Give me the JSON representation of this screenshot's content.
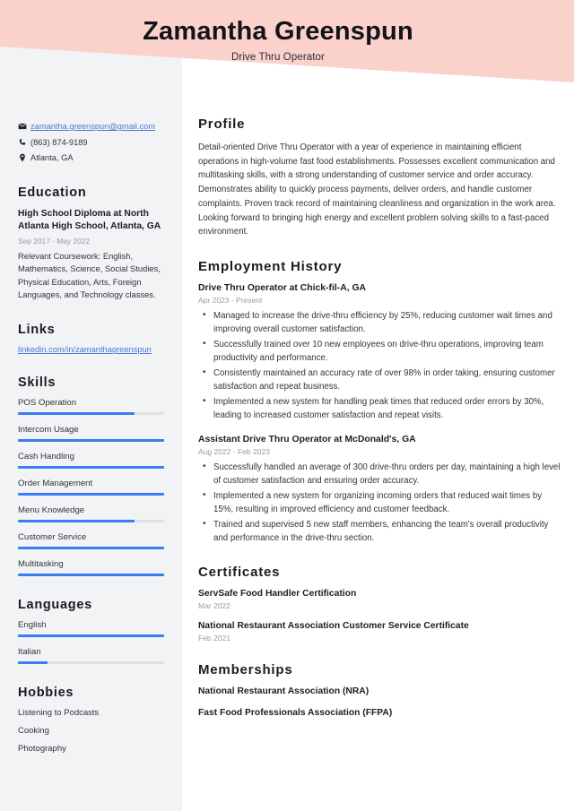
{
  "theme": {
    "accent_pink": "#fbd1cc",
    "accent_blue": "#3b7df5",
    "link_blue": "#4a78d8",
    "sidebar_bg": "#f1f3f4",
    "text_dark": "#1d1d28",
    "text_body": "#33333d",
    "text_muted": "#9a9aa4"
  },
  "header": {
    "name": "Zamantha Greenspun",
    "job_title": "Drive Thru Operator"
  },
  "contact": {
    "email": "zamantha.greenspun@gmail.com",
    "phone": "(863) 874-9189",
    "location": "Atlanta, GA",
    "email_icon": "envelope-icon",
    "phone_icon": "phone-icon",
    "location_icon": "map-pin-icon"
  },
  "education": {
    "heading": "Education",
    "items": [
      {
        "title": "High School Diploma at North Atlanta High School, Atlanta, GA",
        "date": "Sep 2017 - May 2022",
        "description": "Relevant Coursework: English, Mathematics, Science, Social Studies, Physical Education, Arts, Foreign Languages, and Technology classes."
      }
    ]
  },
  "links": {
    "heading": "Links",
    "items": [
      {
        "label": "linkedin.com/in/zamanthagreenspun"
      }
    ]
  },
  "skills": {
    "heading": "Skills",
    "items": [
      {
        "label": "POS Operation",
        "level": 80
      },
      {
        "label": "Intercom Usage",
        "level": 100
      },
      {
        "label": "Cash Handling",
        "level": 100
      },
      {
        "label": "Order Management",
        "level": 100
      },
      {
        "label": "Menu Knowledge",
        "level": 80
      },
      {
        "label": "Customer Service",
        "level": 100
      },
      {
        "label": "Multitasking",
        "level": 100
      }
    ]
  },
  "languages": {
    "heading": "Languages",
    "items": [
      {
        "label": "English",
        "level": 100
      },
      {
        "label": "Italian",
        "level": 20
      }
    ]
  },
  "hobbies": {
    "heading": "Hobbies",
    "items": [
      {
        "label": "Listening to Podcasts"
      },
      {
        "label": "Cooking"
      },
      {
        "label": "Photography"
      }
    ]
  },
  "profile": {
    "heading": "Profile",
    "text": "Detail-oriented Drive Thru Operator with a year of experience in maintaining efficient operations in high-volume fast food establishments. Possesses excellent communication and multitasking skills, with a strong understanding of customer service and order accuracy. Demonstrates ability to quickly process payments, deliver orders, and handle customer complaints. Proven track record of maintaining cleanliness and organization in the work area. Looking forward to bringing high energy and excellent problem solving skills to a fast-paced environment."
  },
  "employment": {
    "heading": "Employment History",
    "jobs": [
      {
        "title": "Drive Thru Operator at Chick-fil-A, GA",
        "date": "Apr 2023 - Present",
        "bullets": [
          "Managed to increase the drive-thru efficiency by 25%, reducing customer wait times and improving overall customer satisfaction.",
          "Successfully trained over 10 new employees on drive-thru operations, improving team productivity and performance.",
          "Consistently maintained an accuracy rate of over 98% in order taking, ensuring customer satisfaction and repeat business.",
          "Implemented a new system for handling peak times that reduced order errors by 30%, leading to increased customer satisfaction and repeat visits."
        ]
      },
      {
        "title": "Assistant Drive Thru Operator at McDonald's, GA",
        "date": "Aug 2022 - Feb 2023",
        "bullets": [
          "Successfully handled an average of 300 drive-thru orders per day, maintaining a high level of customer satisfaction and ensuring order accuracy.",
          "Implemented a new system for organizing incoming orders that reduced wait times by 15%, resulting in improved efficiency and customer feedback.",
          "Trained and supervised 5 new staff members, enhancing the team's overall productivity and performance in the drive-thru section."
        ]
      }
    ]
  },
  "certificates": {
    "heading": "Certificates",
    "items": [
      {
        "name": "ServSafe Food Handler Certification",
        "date": "Mar 2022"
      },
      {
        "name": "National Restaurant Association Customer Service Certificate",
        "date": "Feb 2021"
      }
    ]
  },
  "memberships": {
    "heading": "Memberships",
    "items": [
      {
        "name": "National Restaurant Association (NRA)"
      },
      {
        "name": "Fast Food Professionals Association (FFPA)"
      }
    ]
  }
}
